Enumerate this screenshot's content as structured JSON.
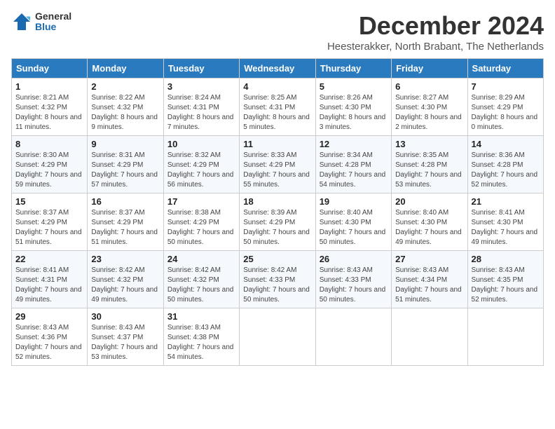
{
  "header": {
    "logo_general": "General",
    "logo_blue": "Blue",
    "title": "December 2024",
    "subtitle": "Heesterakker, North Brabant, The Netherlands"
  },
  "weekdays": [
    "Sunday",
    "Monday",
    "Tuesday",
    "Wednesday",
    "Thursday",
    "Friday",
    "Saturday"
  ],
  "weeks": [
    [
      {
        "day": "1",
        "sunrise": "Sunrise: 8:21 AM",
        "sunset": "Sunset: 4:32 PM",
        "daylight": "Daylight: 8 hours and 11 minutes."
      },
      {
        "day": "2",
        "sunrise": "Sunrise: 8:22 AM",
        "sunset": "Sunset: 4:32 PM",
        "daylight": "Daylight: 8 hours and 9 minutes."
      },
      {
        "day": "3",
        "sunrise": "Sunrise: 8:24 AM",
        "sunset": "Sunset: 4:31 PM",
        "daylight": "Daylight: 8 hours and 7 minutes."
      },
      {
        "day": "4",
        "sunrise": "Sunrise: 8:25 AM",
        "sunset": "Sunset: 4:31 PM",
        "daylight": "Daylight: 8 hours and 5 minutes."
      },
      {
        "day": "5",
        "sunrise": "Sunrise: 8:26 AM",
        "sunset": "Sunset: 4:30 PM",
        "daylight": "Daylight: 8 hours and 3 minutes."
      },
      {
        "day": "6",
        "sunrise": "Sunrise: 8:27 AM",
        "sunset": "Sunset: 4:30 PM",
        "daylight": "Daylight: 8 hours and 2 minutes."
      },
      {
        "day": "7",
        "sunrise": "Sunrise: 8:29 AM",
        "sunset": "Sunset: 4:29 PM",
        "daylight": "Daylight: 8 hours and 0 minutes."
      }
    ],
    [
      {
        "day": "8",
        "sunrise": "Sunrise: 8:30 AM",
        "sunset": "Sunset: 4:29 PM",
        "daylight": "Daylight: 7 hours and 59 minutes."
      },
      {
        "day": "9",
        "sunrise": "Sunrise: 8:31 AM",
        "sunset": "Sunset: 4:29 PM",
        "daylight": "Daylight: 7 hours and 57 minutes."
      },
      {
        "day": "10",
        "sunrise": "Sunrise: 8:32 AM",
        "sunset": "Sunset: 4:29 PM",
        "daylight": "Daylight: 7 hours and 56 minutes."
      },
      {
        "day": "11",
        "sunrise": "Sunrise: 8:33 AM",
        "sunset": "Sunset: 4:29 PM",
        "daylight": "Daylight: 7 hours and 55 minutes."
      },
      {
        "day": "12",
        "sunrise": "Sunrise: 8:34 AM",
        "sunset": "Sunset: 4:28 PM",
        "daylight": "Daylight: 7 hours and 54 minutes."
      },
      {
        "day": "13",
        "sunrise": "Sunrise: 8:35 AM",
        "sunset": "Sunset: 4:28 PM",
        "daylight": "Daylight: 7 hours and 53 minutes."
      },
      {
        "day": "14",
        "sunrise": "Sunrise: 8:36 AM",
        "sunset": "Sunset: 4:28 PM",
        "daylight": "Daylight: 7 hours and 52 minutes."
      }
    ],
    [
      {
        "day": "15",
        "sunrise": "Sunrise: 8:37 AM",
        "sunset": "Sunset: 4:29 PM",
        "daylight": "Daylight: 7 hours and 51 minutes."
      },
      {
        "day": "16",
        "sunrise": "Sunrise: 8:37 AM",
        "sunset": "Sunset: 4:29 PM",
        "daylight": "Daylight: 7 hours and 51 minutes."
      },
      {
        "day": "17",
        "sunrise": "Sunrise: 8:38 AM",
        "sunset": "Sunset: 4:29 PM",
        "daylight": "Daylight: 7 hours and 50 minutes."
      },
      {
        "day": "18",
        "sunrise": "Sunrise: 8:39 AM",
        "sunset": "Sunset: 4:29 PM",
        "daylight": "Daylight: 7 hours and 50 minutes."
      },
      {
        "day": "19",
        "sunrise": "Sunrise: 8:40 AM",
        "sunset": "Sunset: 4:30 PM",
        "daylight": "Daylight: 7 hours and 50 minutes."
      },
      {
        "day": "20",
        "sunrise": "Sunrise: 8:40 AM",
        "sunset": "Sunset: 4:30 PM",
        "daylight": "Daylight: 7 hours and 49 minutes."
      },
      {
        "day": "21",
        "sunrise": "Sunrise: 8:41 AM",
        "sunset": "Sunset: 4:30 PM",
        "daylight": "Daylight: 7 hours and 49 minutes."
      }
    ],
    [
      {
        "day": "22",
        "sunrise": "Sunrise: 8:41 AM",
        "sunset": "Sunset: 4:31 PM",
        "daylight": "Daylight: 7 hours and 49 minutes."
      },
      {
        "day": "23",
        "sunrise": "Sunrise: 8:42 AM",
        "sunset": "Sunset: 4:32 PM",
        "daylight": "Daylight: 7 hours and 49 minutes."
      },
      {
        "day": "24",
        "sunrise": "Sunrise: 8:42 AM",
        "sunset": "Sunset: 4:32 PM",
        "daylight": "Daylight: 7 hours and 50 minutes."
      },
      {
        "day": "25",
        "sunrise": "Sunrise: 8:42 AM",
        "sunset": "Sunset: 4:33 PM",
        "daylight": "Daylight: 7 hours and 50 minutes."
      },
      {
        "day": "26",
        "sunrise": "Sunrise: 8:43 AM",
        "sunset": "Sunset: 4:33 PM",
        "daylight": "Daylight: 7 hours and 50 minutes."
      },
      {
        "day": "27",
        "sunrise": "Sunrise: 8:43 AM",
        "sunset": "Sunset: 4:34 PM",
        "daylight": "Daylight: 7 hours and 51 minutes."
      },
      {
        "day": "28",
        "sunrise": "Sunrise: 8:43 AM",
        "sunset": "Sunset: 4:35 PM",
        "daylight": "Daylight: 7 hours and 52 minutes."
      }
    ],
    [
      {
        "day": "29",
        "sunrise": "Sunrise: 8:43 AM",
        "sunset": "Sunset: 4:36 PM",
        "daylight": "Daylight: 7 hours and 52 minutes."
      },
      {
        "day": "30",
        "sunrise": "Sunrise: 8:43 AM",
        "sunset": "Sunset: 4:37 PM",
        "daylight": "Daylight: 7 hours and 53 minutes."
      },
      {
        "day": "31",
        "sunrise": "Sunrise: 8:43 AM",
        "sunset": "Sunset: 4:38 PM",
        "daylight": "Daylight: 7 hours and 54 minutes."
      },
      null,
      null,
      null,
      null
    ]
  ]
}
